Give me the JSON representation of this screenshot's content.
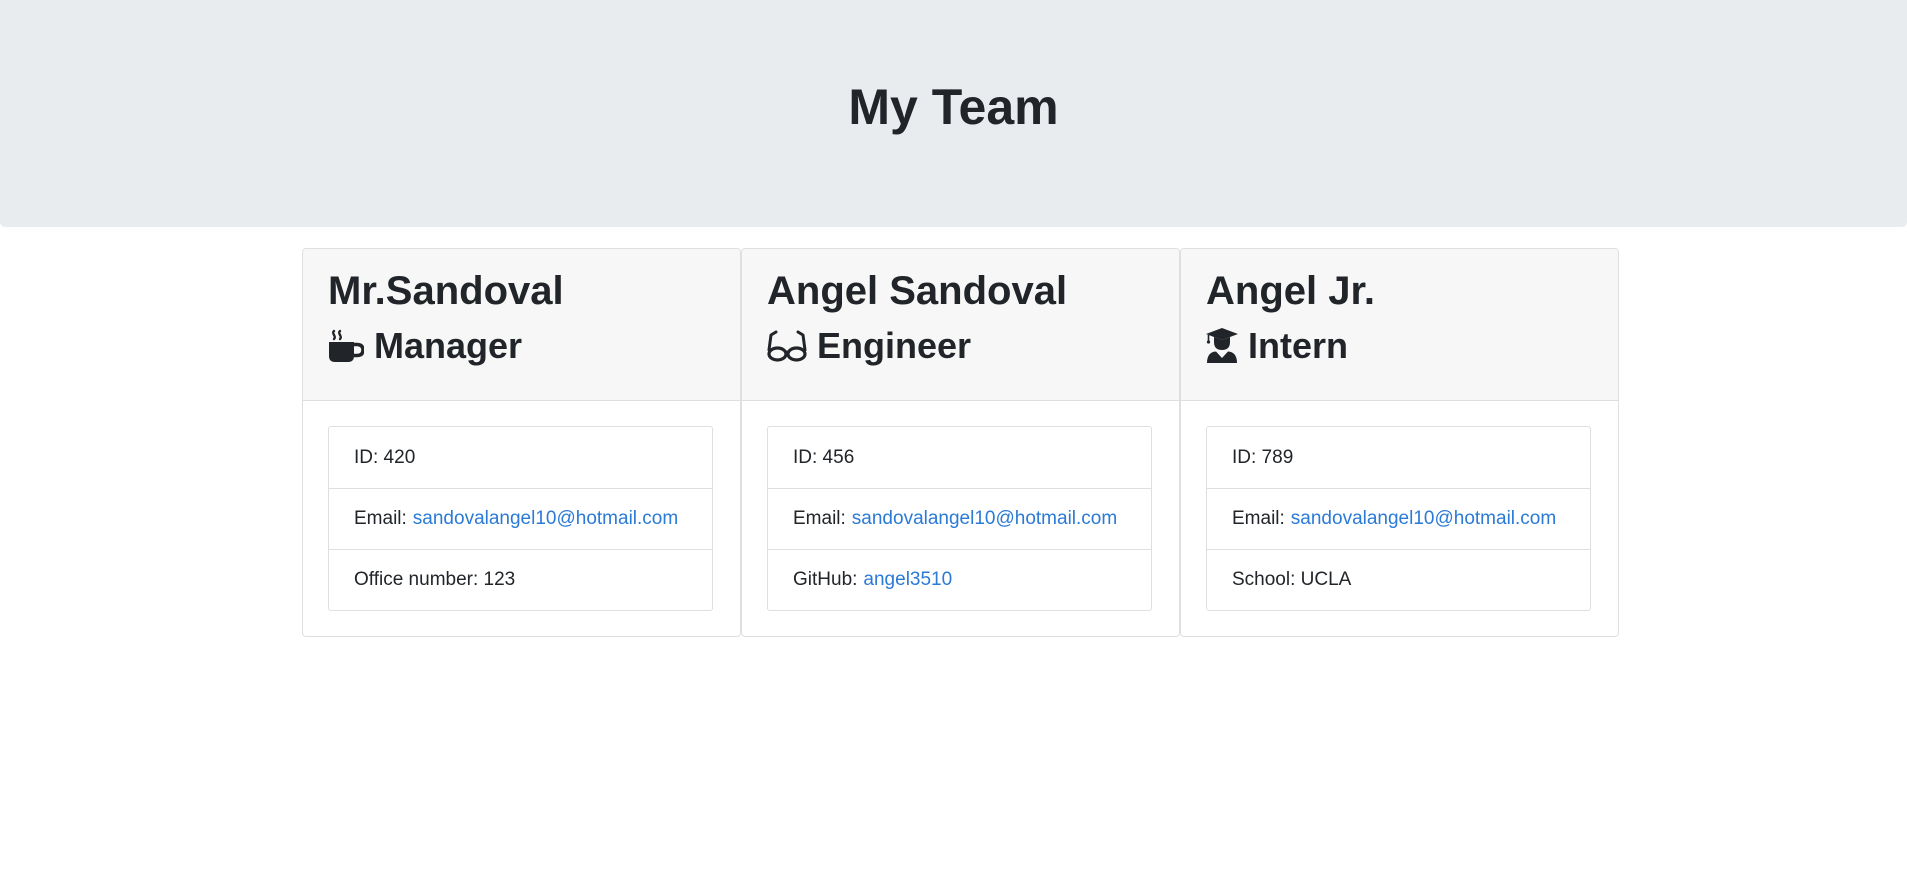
{
  "header": {
    "title": "My Team"
  },
  "cards": [
    {
      "name": "Mr.Sandoval",
      "role": "Manager",
      "role_icon": "coffee-icon",
      "id_label": "ID: 420",
      "email_label": "Email:",
      "email": "sandovalangel10@hotmail.com",
      "extra_text": "Office number: 123"
    },
    {
      "name": "Angel Sandoval",
      "role": "Engineer",
      "role_icon": "glasses-icon",
      "id_label": "ID: 456",
      "email_label": "Email:",
      "email": "sandovalangel10@hotmail.com",
      "extra_label": "GitHub:",
      "github": "angel3510"
    },
    {
      "name": "Angel Jr.",
      "role": "Intern",
      "role_icon": "graduate-icon",
      "id_label": "ID: 789",
      "email_label": "Email:",
      "email": "sandovalangel10@hotmail.com",
      "extra_text": "School: UCLA"
    }
  ],
  "colors": {
    "header_bg": "#e9ecef",
    "card_header_bg": "#f7f7f7",
    "link": "#2a7ad6",
    "text": "#212529"
  }
}
